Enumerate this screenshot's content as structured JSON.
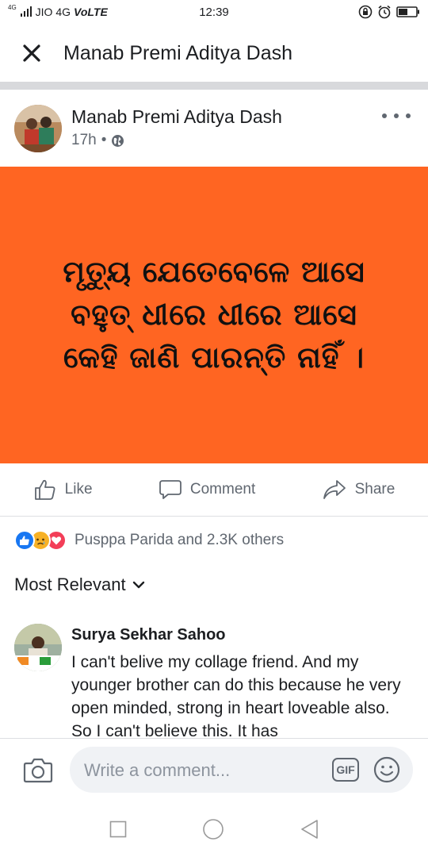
{
  "status_bar": {
    "network_small": "4G",
    "carrier": "JIO 4G",
    "volte": "VoLTE",
    "time": "12:39"
  },
  "header": {
    "title": "Manab Premi Aditya Dash",
    "close_icon": "close-icon"
  },
  "post": {
    "author": "Manab Premi Aditya Dash",
    "time": "17h",
    "privacy_icon": "globe-icon",
    "image_bg_color": "#ff6522",
    "image_text_lines": [
      "ମୃତ୍ୟୁ ଯେତେବେଳେ ଆସେ",
      "ବହୁତ୍ ଧୀରେ ଧୀରେ ଆସେ",
      "କେହି ଜାଣି ପାରନ୍ତି ନାହିଁ ।"
    ]
  },
  "actions": {
    "like": "Like",
    "comment": "Comment",
    "share": "Share"
  },
  "reactions": {
    "summary": "Pusppa Parida and 2.3K others",
    "icons": [
      "like-reaction-icon",
      "sad-reaction-icon",
      "love-reaction-icon"
    ]
  },
  "sort": {
    "label": "Most Relevant"
  },
  "comment": {
    "author": "Surya Sekhar Sahoo",
    "text": "I can't belive my collage friend. And my younger brother can do this because he very open minded, strong in heart loveable also. So I can't believe this. It has"
  },
  "composer": {
    "placeholder": "Write a comment...",
    "gif_label": "GIF"
  },
  "colors": {
    "accent": "#1877f2",
    "post_bg": "#ff6522",
    "secondary_text": "#606770"
  }
}
